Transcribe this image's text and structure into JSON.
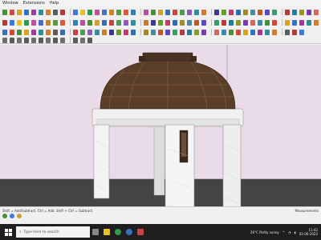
{
  "menu": [
    "Window",
    "Extensions",
    "Help"
  ],
  "toolbar_icons": {
    "row1": [
      "#4a8f3b",
      "#d14a3a",
      "#e0a020",
      "#3670c0",
      "#a03a9a",
      "#2d8f8f",
      "#d87a2b",
      "#5a5a5a",
      "#b23c3c",
      "#3d7ad9",
      "#e6c025",
      "#2e9c4d",
      "#c44d9e",
      "#4a6ec0",
      "#c4892a",
      "#5a9b3c",
      "#d95a3a",
      "#2f7fb8",
      "#b64fa0",
      "#4d8e3e",
      "#d0a030",
      "#3a6db0",
      "#c84343",
      "#4c9a5a",
      "#8e5ac0",
      "#2f8ea0",
      "#d07a30",
      "#3a3a8a",
      "#6a9a2a",
      "#c43a6a",
      "#2f6faf",
      "#a08a2a",
      "#4a8a9a",
      "#c05a2a",
      "#5a4ac0",
      "#3a9a6a",
      "#b83a3a",
      "#2a7aa0",
      "#909a2a",
      "#7a3ab0",
      "#d06a5a",
      "#3a8ab0"
    ],
    "row2": [
      "#b23c3c",
      "#3d7ad9",
      "#e6c025",
      "#2e9c4d",
      "#c44d9e",
      "#4a6ec0",
      "#c4892a",
      "#5a9b3c",
      "#d95a3a",
      "#2f7fb8",
      "#b64fa0",
      "#4d8e3e",
      "#d0a030",
      "#3a6db0",
      "#c84343",
      "#4c9a5a",
      "#8e5ac0",
      "#2f8ea0",
      "#d07a30",
      "#3a3a8a",
      "#6a9a2a",
      "#c43a6a",
      "#2f6faf",
      "#a08a2a",
      "#4a8a9a",
      "#c05a2a",
      "#5a4ac0",
      "#3a9a6a",
      "#b83a3a",
      "#2a7aa0",
      "#909a2a",
      "#7a3ab0",
      "#d06a5a",
      "#3a8ab0",
      "#4a8f3b",
      "#d14a3a",
      "#e0a020",
      "#3670c0",
      "#a03a9a",
      "#2d8f8f",
      "#d87a2b"
    ],
    "row3": [
      "#3670c0",
      "#d14a3a",
      "#4a8f3b",
      "#e0a020",
      "#a03a9a",
      "#2d8f8f",
      "#d87a2b",
      "#5a5a5a",
      "#3a6db0",
      "#c84343",
      "#4c9a5a",
      "#8e5ac0",
      "#2f8ea0",
      "#d07a30",
      "#3a3a8a",
      "#6a9a2a",
      "#c43a6a",
      "#2f6faf",
      "#a08a2a",
      "#4a8a9a",
      "#c05a2a",
      "#5a4ac0",
      "#3a9a6a",
      "#b83a3a",
      "#2a7aa0",
      "#909a2a",
      "#7a3ab0",
      "#d06a5a",
      "#3a8ab0",
      "#4a8f3b",
      "#d14a3a",
      "#e0a020",
      "#3670c0",
      "#a03a9a",
      "#2d8f8f",
      "#d87a2b",
      "#5a5a5a",
      "#b23c3c",
      "#3d7ad9"
    ],
    "row4": [
      "#707070",
      "#5a5a5a",
      "#707070",
      "#5a5a5a",
      "#707070",
      "#5a5a5a",
      "#707070",
      "#5a5a5a",
      "#707070",
      "#5a5a5a",
      "#707070",
      "#5a5a5a"
    ]
  },
  "status": {
    "left": "Shift = Add/Subtract. Ctrl = Add. Shift + Ctrl = Subtract.",
    "right": "Measurements"
  },
  "taskbar": {
    "search_placeholder": "Type here to search",
    "weather": "26°C  Partly sunny",
    "time": "11:42",
    "date": "02-06-2022"
  },
  "colors": {
    "sky": "#e9dbe8",
    "ground": "#444444",
    "dome": "#5a3e28",
    "marble": "#f2f2f2"
  }
}
